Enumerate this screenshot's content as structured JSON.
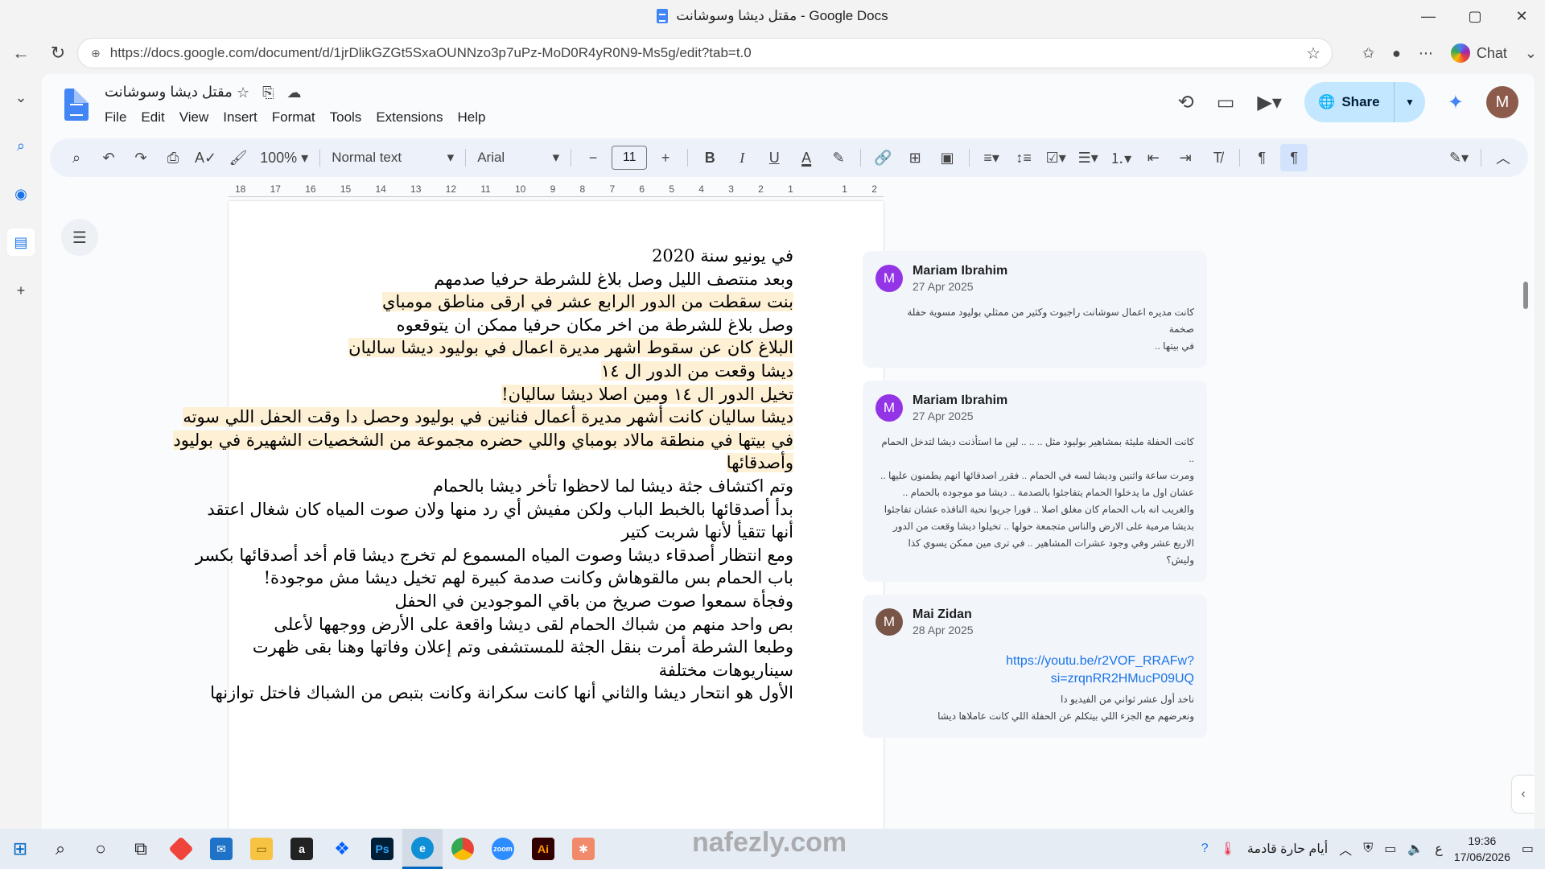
{
  "window": {
    "title": "مقتل ديشا وسوشانت - Google Docs",
    "min": "—",
    "max": "▢",
    "close": "✕"
  },
  "browser": {
    "url": "https://docs.google.com/document/d/1jrDlikGZGt5SxaOUNNzo3p7uPz-MoD0R4yR0N9-Ms5g/edit?tab=t.0",
    "chat_label": "Chat"
  },
  "docs": {
    "doc_title": "مقتل ديشا وسوشانت",
    "menu": [
      "File",
      "Edit",
      "View",
      "Insert",
      "Format",
      "Tools",
      "Extensions",
      "Help"
    ],
    "share_label": "Share",
    "avatar_letter": "M",
    "toolbar": {
      "zoom": "100%",
      "style": "Normal text",
      "font": "Arial",
      "font_size": "11"
    },
    "ruler": [
      "18",
      "17",
      "16",
      "15",
      "14",
      "13",
      "12",
      "11",
      "10",
      "9",
      "8",
      "7",
      "6",
      "5",
      "4",
      "3",
      "2",
      "1",
      "",
      "1",
      "2"
    ]
  },
  "document": {
    "lines": [
      {
        "text": "في يونيو سنة 2020",
        "hl": false
      },
      {
        "text": "وبعد منتصف الليل وصل بلاغ للشرطة حرفيا صدمهم",
        "hl": false
      },
      {
        "text": "بنت سقطت من الدور الرابع عشر في ارقى مناطق مومباي",
        "hl": true
      },
      {
        "text": "وصل بلاغ للشرطة من اخر مكان حرفيا ممكن ان يتوقعوه",
        "hl": false
      },
      {
        "text": "البلاغ كان عن سقوط اشهر مديرة اعمال في بوليود ديشا ساليان",
        "hl": true
      },
      {
        "text": "ديشا وقعت من الدور ال ١٤",
        "hl": true
      },
      {
        "text": "تخيل الدور ال ١٤ ومين اصلا ديشا ساليان!",
        "hl": true
      },
      {
        "text": "ديشا ساليان كانت أشهر مديرة أعمال فنانين في بوليود وحصل دا وقت الحفل اللي سوته",
        "hl": true
      },
      {
        "text": "في بيتها في منطقة مالاد بومباي واللي حضره مجموعة من الشخصيات الشهيرة في بوليود",
        "hl": true
      },
      {
        "text": "وأصدقائها",
        "hl": true
      },
      {
        "text": "وتم اكتشاف جثة ديشا لما لاحظوا تأخر ديشا بالحمام",
        "hl": false
      },
      {
        "text": "بدأ أصدقائها بالخبط  الباب ولكن مفيش أي رد منها  ولان صوت المياه كان شغال اعتقد",
        "hl": false
      },
      {
        "text": "أنها تتقيأ لأنها شربت كتير",
        "hl": false
      },
      {
        "text": "ومع انتظار أصدقاء ديشا وصوت المياه المسموع لم تخرج ديشا  قام أخد  أصدقائها بكسر",
        "hl": false
      },
      {
        "text": "باب الحمام بس مالقوهاش وكانت صدمة كبيرة لهم تخيل ديشا مش موجودة!",
        "hl": false
      },
      {
        "text": "وفجأة سمعوا صوت صريخ من باقي الموجودين في الحفل",
        "hl": false
      },
      {
        "text": "بص واحد منهم من شباك الحمام لقى ديشا واقعة على الأرض ووجهها لأعلى",
        "hl": false
      },
      {
        "text": "وطبعا الشرطة أمرت بنقل الجثة للمستشفى وتم إعلان  وفاتها وهنا بقى ظهرت",
        "hl": false
      },
      {
        "text": "سيناريوهات مختلفة",
        "hl": false
      },
      {
        "text": "الأول هو انتحار ديشا والثاني أنها كانت سكرانة وكانت بتبص من الشباك فاختل توازنها",
        "hl": false
      }
    ]
  },
  "comments": [
    {
      "initial": "M",
      "name": "Mariam Ibrahim",
      "date": "27 Apr 2025",
      "color": "#9334e6",
      "body": [
        "كانت مديره اعمال سوشانت راجبوت وكثير من ممثلي بوليود مسوية حفلة صخمة",
        "في بيتها .."
      ]
    },
    {
      "initial": "M",
      "name": "Mariam Ibrahim",
      "date": "27 Apr 2025",
      "color": "#9334e6",
      "body": [
        "كانت الحفلة مليئة بمشاهير بوليود مثل .. .. .. لين ما استأذنت ديشا لتدخل الحمام ..",
        "ومرت ساعة واثنين وديشا لسه في الحمام .. فقرر اصدقائها انهم يطمنون عليها ..",
        "عشان اول ما يدخلوا الحمام يتفاجئوا بالصدمة .. ديشا مو موجوده بالحمام ..",
        "والغريب انه باب الحمام كان مغلق اصلا .. فورا جريوا نحية النافذه عشان تفاجئوا",
        "بديشا مرمية على الارض والناس متجمعة حولها .. تخيلوا ديشا وقعت من الدور",
        "الاربع عشر وفي وجود عشرات المشاهير .. في ترى مين ممكن يسوي كذا وليش؟"
      ]
    },
    {
      "initial": "M",
      "name": "Mai Zidan",
      "date": "28 Apr 2025",
      "color": "#795548",
      "link": [
        "https://youtu.be/r2VOF_RRAFw?",
        "si=zrqnRR2HMucP09UQ"
      ],
      "body": [
        "ناخد أول عشر ثواني من الفيديو دا",
        "ونعرضهم مع الجزء اللي بيتكلم عن الحفلة اللي كانت عاملاها ديشا"
      ]
    }
  ],
  "taskbar": {
    "time": "19:36",
    "date": "17/06/2026",
    "weather": "أيام حارة قادمة",
    "lang": "ع"
  },
  "watermark": "nafezly.com"
}
